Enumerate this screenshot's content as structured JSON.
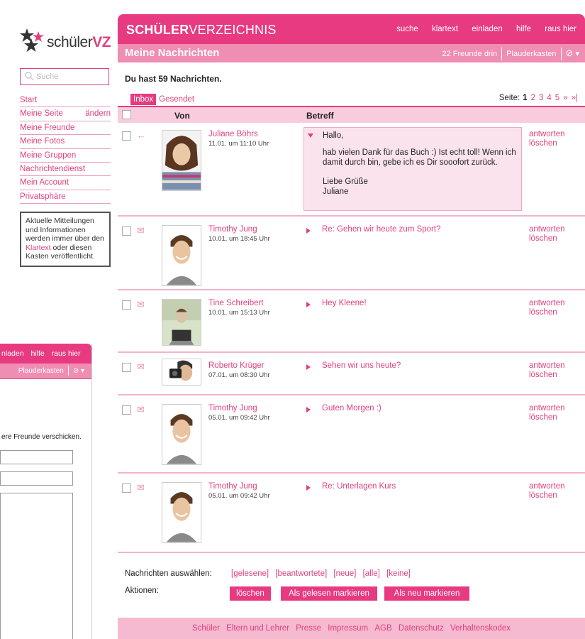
{
  "back_window": {
    "topnav": [
      "nladen",
      "hilfe",
      "raus hier"
    ],
    "subbar_label": "Plauderkasten",
    "text": "ere Freunde verschicken."
  },
  "sidebar": {
    "logo": {
      "prefix": "schüler",
      "suffix": "VZ"
    },
    "search_placeholder": "Suche",
    "nav": [
      {
        "label": "Start"
      },
      {
        "label": "Meine Seite",
        "aside": "ändern"
      },
      {
        "label": "Meine Freunde"
      },
      {
        "label": "Meine Fotos"
      },
      {
        "label": "Meine Gruppen"
      },
      {
        "label": "Nachrichtendienst"
      },
      {
        "label": "Mein Account"
      },
      {
        "label": "Privatsphäre"
      }
    ],
    "infobox": {
      "text_before": "Aktuelle Mitteilungen und Informationen werden immer über den ",
      "link": "Klartext",
      "text_after": " oder diesen Kasten veröffentlicht."
    }
  },
  "header": {
    "brand_bold": "SCHÜLER",
    "brand_rest": "VERZEICHNIS",
    "nav": [
      "suche",
      "klartext",
      "einladen",
      "hilfe",
      "raus hier"
    ],
    "subtitle": "Meine Nachrichten",
    "friends_online": "22 Freunde drin",
    "plauderkasten": "Plauderkasten"
  },
  "messages_page": {
    "count_text": "Du hast 59 Nachrichten.",
    "tabs": [
      "Inbox",
      "Gesendet"
    ],
    "pager": {
      "label": "Seite:",
      "current": "1",
      "pages": [
        "2",
        "3",
        "4",
        "5"
      ],
      "next": "»",
      "last": "»|"
    },
    "columns": {
      "from": "Von",
      "subject": "Betreff"
    },
    "open_message": {
      "greeting": "Hallo,",
      "body": "hab vielen Dank für das Buch :) Ist echt toll! Wenn ich damit durch bin, gebe ich es Dir sooofort zurück.",
      "closing": "Liebe Grüße",
      "signature": "Juliane"
    },
    "rows": [
      {
        "sender": "Juliane Böhrs",
        "date": "11.01. um 11:10 Uhr",
        "subject": "Hallo,",
        "reply": "antworten",
        "delete": "löschen",
        "state_icon": "replied-arrow-icon",
        "photo_colors": [
          "#e9c9a8",
          "#7a4a2a",
          "#c43b6a"
        ]
      },
      {
        "sender": "Timothy Jung",
        "date": "10.01. um 18:45 Uhr",
        "subject": "Re: Gehen wir heute zum Sport?",
        "reply": "antworten",
        "delete": "löschen",
        "state_icon": "envelope-icon",
        "photo_colors": [
          "#eac4a1",
          "#5a3a22",
          "#ffffff"
        ]
      },
      {
        "sender": "Tine Schreibert",
        "date": "10.01. um 15:13 Uhr",
        "subject": "Hey Kleene!",
        "reply": "antworten",
        "delete": "löschen",
        "state_icon": "envelope-icon",
        "photo_colors": [
          "#d9c4a8",
          "#3c3c3c",
          "#a9b9a0"
        ]
      },
      {
        "sender": "Roberto Krüger",
        "date": "07.01. um 08:30 Uhr",
        "subject": "Sehen wir uns heute?",
        "reply": "antworten",
        "delete": "löschen",
        "state_icon": "envelope-icon",
        "photo_colors": [
          "#e2b996",
          "#333333",
          "#ffffff"
        ]
      },
      {
        "sender": "Timothy Jung",
        "date": "05.01. um 09:42 Uhr",
        "subject": "Guten Morgen :)",
        "reply": "antworten",
        "delete": "löschen",
        "state_icon": "envelope-icon",
        "photo_colors": [
          "#eac4a1",
          "#5a3a22",
          "#ffffff"
        ]
      },
      {
        "sender": "Timothy Jung",
        "date": "05.01. um 09:42 Uhr",
        "subject": "Re: Unterlagen Kurs",
        "reply": "antworten",
        "delete": "löschen",
        "state_icon": "envelope-icon",
        "photo_colors": [
          "#eac4a1",
          "#5a3a22",
          "#ffffff"
        ]
      }
    ],
    "select_label": "Nachrichten auswählen:",
    "select_options": [
      "[gelesene]",
      "[beantwortete]",
      "[neue]",
      "[alle]",
      "[keine]"
    ],
    "actions_label": "Aktionen:",
    "action_buttons": [
      "löschen",
      "Als gelesen markieren",
      "Als neu markieren"
    ]
  },
  "footer_links": [
    "Schüler",
    "Eltern und Lehrer",
    "Presse",
    "Impressum",
    "AGB",
    "Datenschutz",
    "Verhaltenskodex"
  ],
  "colors": {
    "brand_pink": "#e83a80",
    "light_pink": "#f08db3",
    "row_pink": "#fbe3ed"
  }
}
